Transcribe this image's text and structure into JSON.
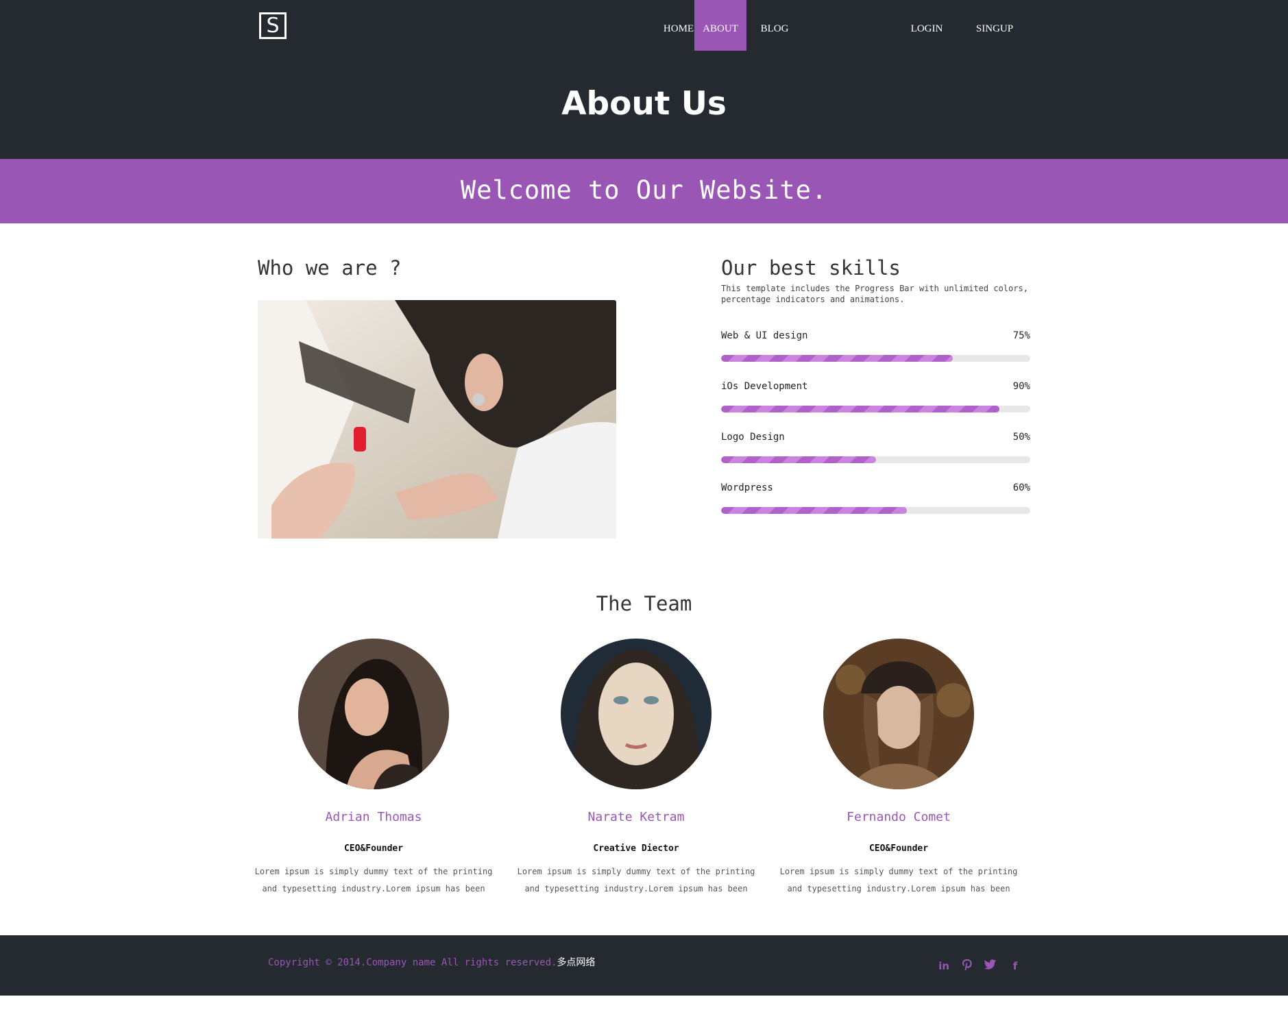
{
  "brand": {
    "logo_letter": "S"
  },
  "nav": {
    "home": "HOME",
    "about": "ABOUT",
    "blog": "BLOG",
    "login": "LOGIN",
    "signup": "SINGUP"
  },
  "header": {
    "title": "About Us"
  },
  "banner": {
    "text": "Welcome to Our Website."
  },
  "who": {
    "heading": "Who we are ?"
  },
  "skills": {
    "heading": "Our best skills",
    "description": "This template includes the Progress Bar with unlimited colors, percentage indicators and animations.",
    "items": [
      {
        "name": "Web & UI design",
        "pct_label": "75%",
        "value": 75
      },
      {
        "name": "iOs Development",
        "pct_label": "90%",
        "value": 90
      },
      {
        "name": "Logo Design",
        "pct_label": "50%",
        "value": 50
      },
      {
        "name": "Wordpress",
        "pct_label": "60%",
        "value": 60
      }
    ]
  },
  "team": {
    "title": "The Team",
    "members": [
      {
        "name": "Adrian Thomas",
        "role": "CEO&Founder",
        "bio": "Lorem ipsum is simply dummy text of the printing and typesetting industry.Lorem ipsum has been"
      },
      {
        "name": "Narate Ketram",
        "role": "Creative Diector",
        "bio": "Lorem ipsum is simply dummy text of the printing and typesetting industry.Lorem ipsum has been"
      },
      {
        "name": "Fernando Comet",
        "role": "CEO&Founder",
        "bio": "Lorem ipsum is simply dummy text of the printing and typesetting industry.Lorem ipsum has been"
      }
    ]
  },
  "footer": {
    "copyright": "Copyright © 2014.Company name All rights reserved.",
    "brand_link": "多点网络",
    "social": [
      "linkedin-icon",
      "pinterest-icon",
      "twitter-icon",
      "facebook-icon"
    ]
  },
  "colors": {
    "accent": "#9a56b5",
    "dark": "#252a30",
    "bar": "#b061c9",
    "track": "#e8e8e8"
  }
}
